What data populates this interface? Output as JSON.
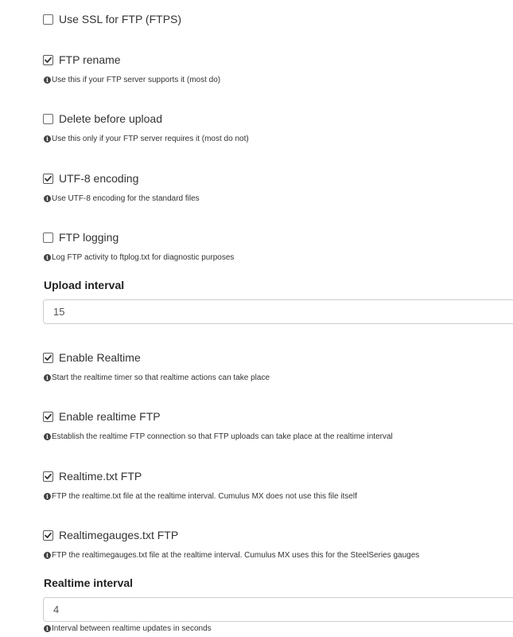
{
  "settings": {
    "use_ssl": {
      "label": "Use SSL for FTP (FTPS)",
      "checked": false
    },
    "ftp_rename": {
      "label": "FTP rename",
      "checked": true,
      "help": "Use this if your FTP server supports it (most do)"
    },
    "delete_before_upload": {
      "label": "Delete before upload",
      "checked": false,
      "help": "Use this only if your FTP server requires it (most do not)"
    },
    "utf8_encoding": {
      "label": "UTF-8 encoding",
      "checked": true,
      "help": "Use UTF-8 encoding for the standard files"
    },
    "ftp_logging": {
      "label": "FTP logging",
      "checked": false,
      "help": "Log FTP activity to ftplog.txt for diagnostic purposes"
    },
    "upload_interval": {
      "label": "Upload interval",
      "value": "15"
    },
    "enable_realtime": {
      "label": "Enable Realtime",
      "checked": true,
      "help": "Start the realtime timer so that realtime actions can take place"
    },
    "enable_realtime_ftp": {
      "label": "Enable realtime FTP",
      "checked": true,
      "help": "Establish the realtime FTP connection so that FTP uploads can take place at the realtime interval"
    },
    "realtime_txt_ftp": {
      "label": "Realtime.txt FTP",
      "checked": true,
      "help": "FTP the realtime.txt file at the realtime interval. Cumulus MX does not use this file itself"
    },
    "realtimegauges_txt_ftp": {
      "label": "Realtimegauges.txt FTP",
      "checked": true,
      "help": "FTP the realtimegauges.txt file at the realtime interval. Cumulus MX uses this for the SteelSeries gauges"
    },
    "realtime_interval": {
      "label": "Realtime interval",
      "value": "4",
      "help": "Interval between realtime updates in seconds"
    }
  }
}
